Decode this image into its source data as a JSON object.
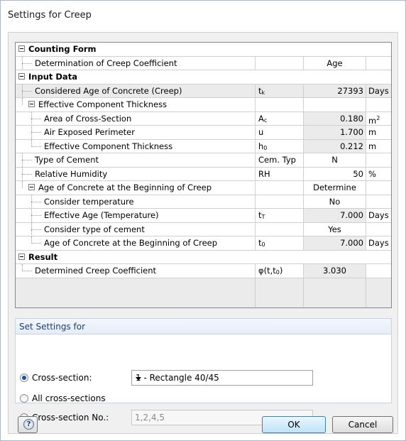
{
  "window": {
    "title": "Settings for Creep"
  },
  "grid": {
    "rows": [
      {
        "type": "section",
        "label": "Counting Form"
      },
      {
        "type": "item",
        "label": "Determination of Creep Coefficient",
        "symbol": "",
        "value": "Age",
        "unit": ""
      },
      {
        "type": "section",
        "label": "Input Data"
      },
      {
        "type": "item",
        "label": "Considered Age of Concrete (Creep)",
        "symbol": "t",
        "symbol_sub": "k",
        "value": "27393",
        "unit": "Days"
      },
      {
        "type": "group",
        "label": "Effective Component Thickness"
      },
      {
        "type": "subitem",
        "label": "Area of Cross-Section",
        "symbol": "A",
        "symbol_sub": "c",
        "value": "0.180",
        "unit": "m",
        "unit_sup": "2"
      },
      {
        "type": "subitem",
        "label": "Air Exposed Perimeter",
        "symbol": "u",
        "symbol_sub": "",
        "value": "1.700",
        "unit": "m"
      },
      {
        "type": "subitem",
        "label": "Effective Component Thickness",
        "symbol": "h",
        "symbol_sub": "0",
        "value": "0.212",
        "unit": "m"
      },
      {
        "type": "item",
        "label": "Type of Cement",
        "symbol": "Cem. Typ",
        "value": "N",
        "unit": ""
      },
      {
        "type": "item",
        "label": "Relative Humidity",
        "symbol": "RH",
        "value": "50",
        "unit": "%"
      },
      {
        "type": "group",
        "label": "Age of Concrete at the Beginning of Creep",
        "value": "Determine"
      },
      {
        "type": "subitem",
        "label": "Consider temperature",
        "symbol": "",
        "value": "No",
        "unit": ""
      },
      {
        "type": "subitem",
        "label": "Effective Age (Temperature)",
        "symbol": "t",
        "symbol_sub": "T",
        "value": "7.000",
        "unit": "Days"
      },
      {
        "type": "subitem",
        "label": "Consider type of cement",
        "symbol": "",
        "value": "Yes",
        "unit": ""
      },
      {
        "type": "subitem",
        "label": "Age of Concrete at the Beginning of Creep",
        "symbol": "t",
        "symbol_sub": "0",
        "value": "7.000",
        "unit": "Days"
      },
      {
        "type": "section",
        "label": "Result"
      },
      {
        "type": "item",
        "label": "Determined Creep Coefficient",
        "symbol": "φ(t,t",
        "symbol_sub": "0",
        "symbol_tail": ")",
        "value": "3.030",
        "unit": ""
      }
    ]
  },
  "set_settings": {
    "title": "Set Settings for",
    "option_cross_section": "Cross-section:",
    "option_all": "All cross-sections",
    "option_number": "Cross-section No.:",
    "selected_cross_section": "1 - Rectangle 40/45",
    "number_placeholder": "1,2,4,5"
  },
  "footer": {
    "ok": "OK",
    "cancel": "Cancel",
    "help_glyph": "?"
  }
}
